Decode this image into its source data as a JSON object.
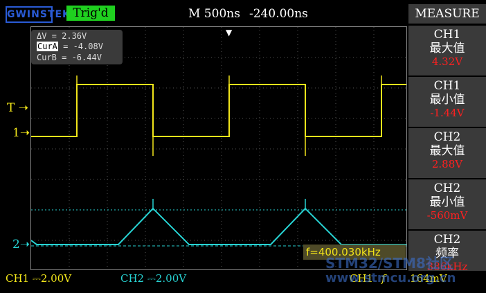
{
  "header": {
    "logo": "GWINSTEK",
    "trigger_status": "Trig'd",
    "timebase": "M 500ns",
    "offset": "-240.00ns"
  },
  "cursors": {
    "delta": "ΔV  = 2.36V",
    "cura_label": "CurA",
    "cura_value": " = -4.08V",
    "curb": "CurB = -6.44V"
  },
  "markers": {
    "trigger": "T",
    "ch1": "1",
    "ch2": "2"
  },
  "frequency_readout": "f=400.030kHz",
  "bottom": {
    "ch1_scale": "CH1 ⎓2.00V",
    "ch2_scale": "CH2 ⎓2.00V",
    "trigger_source": "CH1",
    "trigger_edge": "f",
    "trigger_level": "164mV"
  },
  "measure": {
    "title": "MEASURE",
    "items": [
      {
        "channel": "CH1",
        "name": "最大值",
        "value": "4.32V"
      },
      {
        "channel": "CH1",
        "name": "最小值",
        "value": "-1.44V"
      },
      {
        "channel": "CH2",
        "name": "最大值",
        "value": "2.88V"
      },
      {
        "channel": "CH2",
        "name": "最小值",
        "value": "-560mV"
      },
      {
        "channel": "CH2",
        "name": "频率",
        "value": "386kHz"
      }
    ]
  },
  "watermark": {
    "line1": "STM32/STM8社区",
    "line2": "www.stmcu.org.cn"
  },
  "colors": {
    "ch1": "#f2e61a",
    "ch2": "#27d3d3",
    "value": "#ff2020",
    "trig_bg": "#1fd01f"
  }
}
